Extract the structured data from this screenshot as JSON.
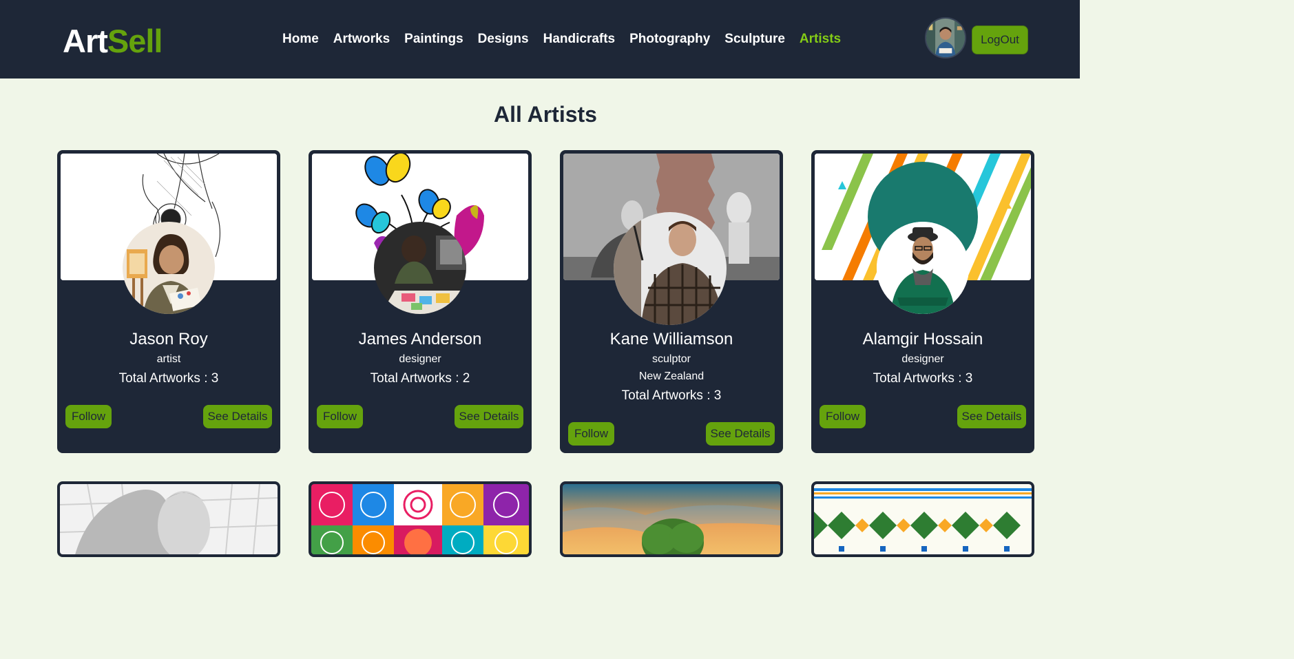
{
  "app": {
    "logo_part1": "Art",
    "logo_part2": "Sell"
  },
  "nav": {
    "links": [
      "Home",
      "Artworks",
      "Paintings",
      "Designs",
      "Handicrafts",
      "Photography",
      "Sculpture",
      "Artists"
    ],
    "active": "Artists",
    "logout_label": "LogOut"
  },
  "page": {
    "title": "All Artists"
  },
  "artists": [
    {
      "name": "Jason Roy",
      "role": "artist",
      "country": "",
      "total_artworks": "Total Artworks : 3",
      "follow_label": "Follow",
      "details_label": "See Details"
    },
    {
      "name": "James Anderson",
      "role": "designer",
      "country": "",
      "total_artworks": "Total Artworks : 2",
      "follow_label": "Follow",
      "details_label": "See Details"
    },
    {
      "name": "Kane Williamson",
      "role": "sculptor",
      "country": "New Zealand",
      "total_artworks": "Total Artworks : 3",
      "follow_label": "Follow",
      "details_label": "See Details"
    },
    {
      "name": "Alamgir Hossain",
      "role": "designer",
      "country": "",
      "total_artworks": "Total Artworks : 3",
      "follow_label": "Follow",
      "details_label": "See Details"
    }
  ],
  "colors": {
    "navbar_bg": "#1e2737",
    "accent_green": "#65a30d",
    "active_link": "#84cc16",
    "page_bg": "#f0f6e8",
    "card_bg": "#1e2737"
  }
}
